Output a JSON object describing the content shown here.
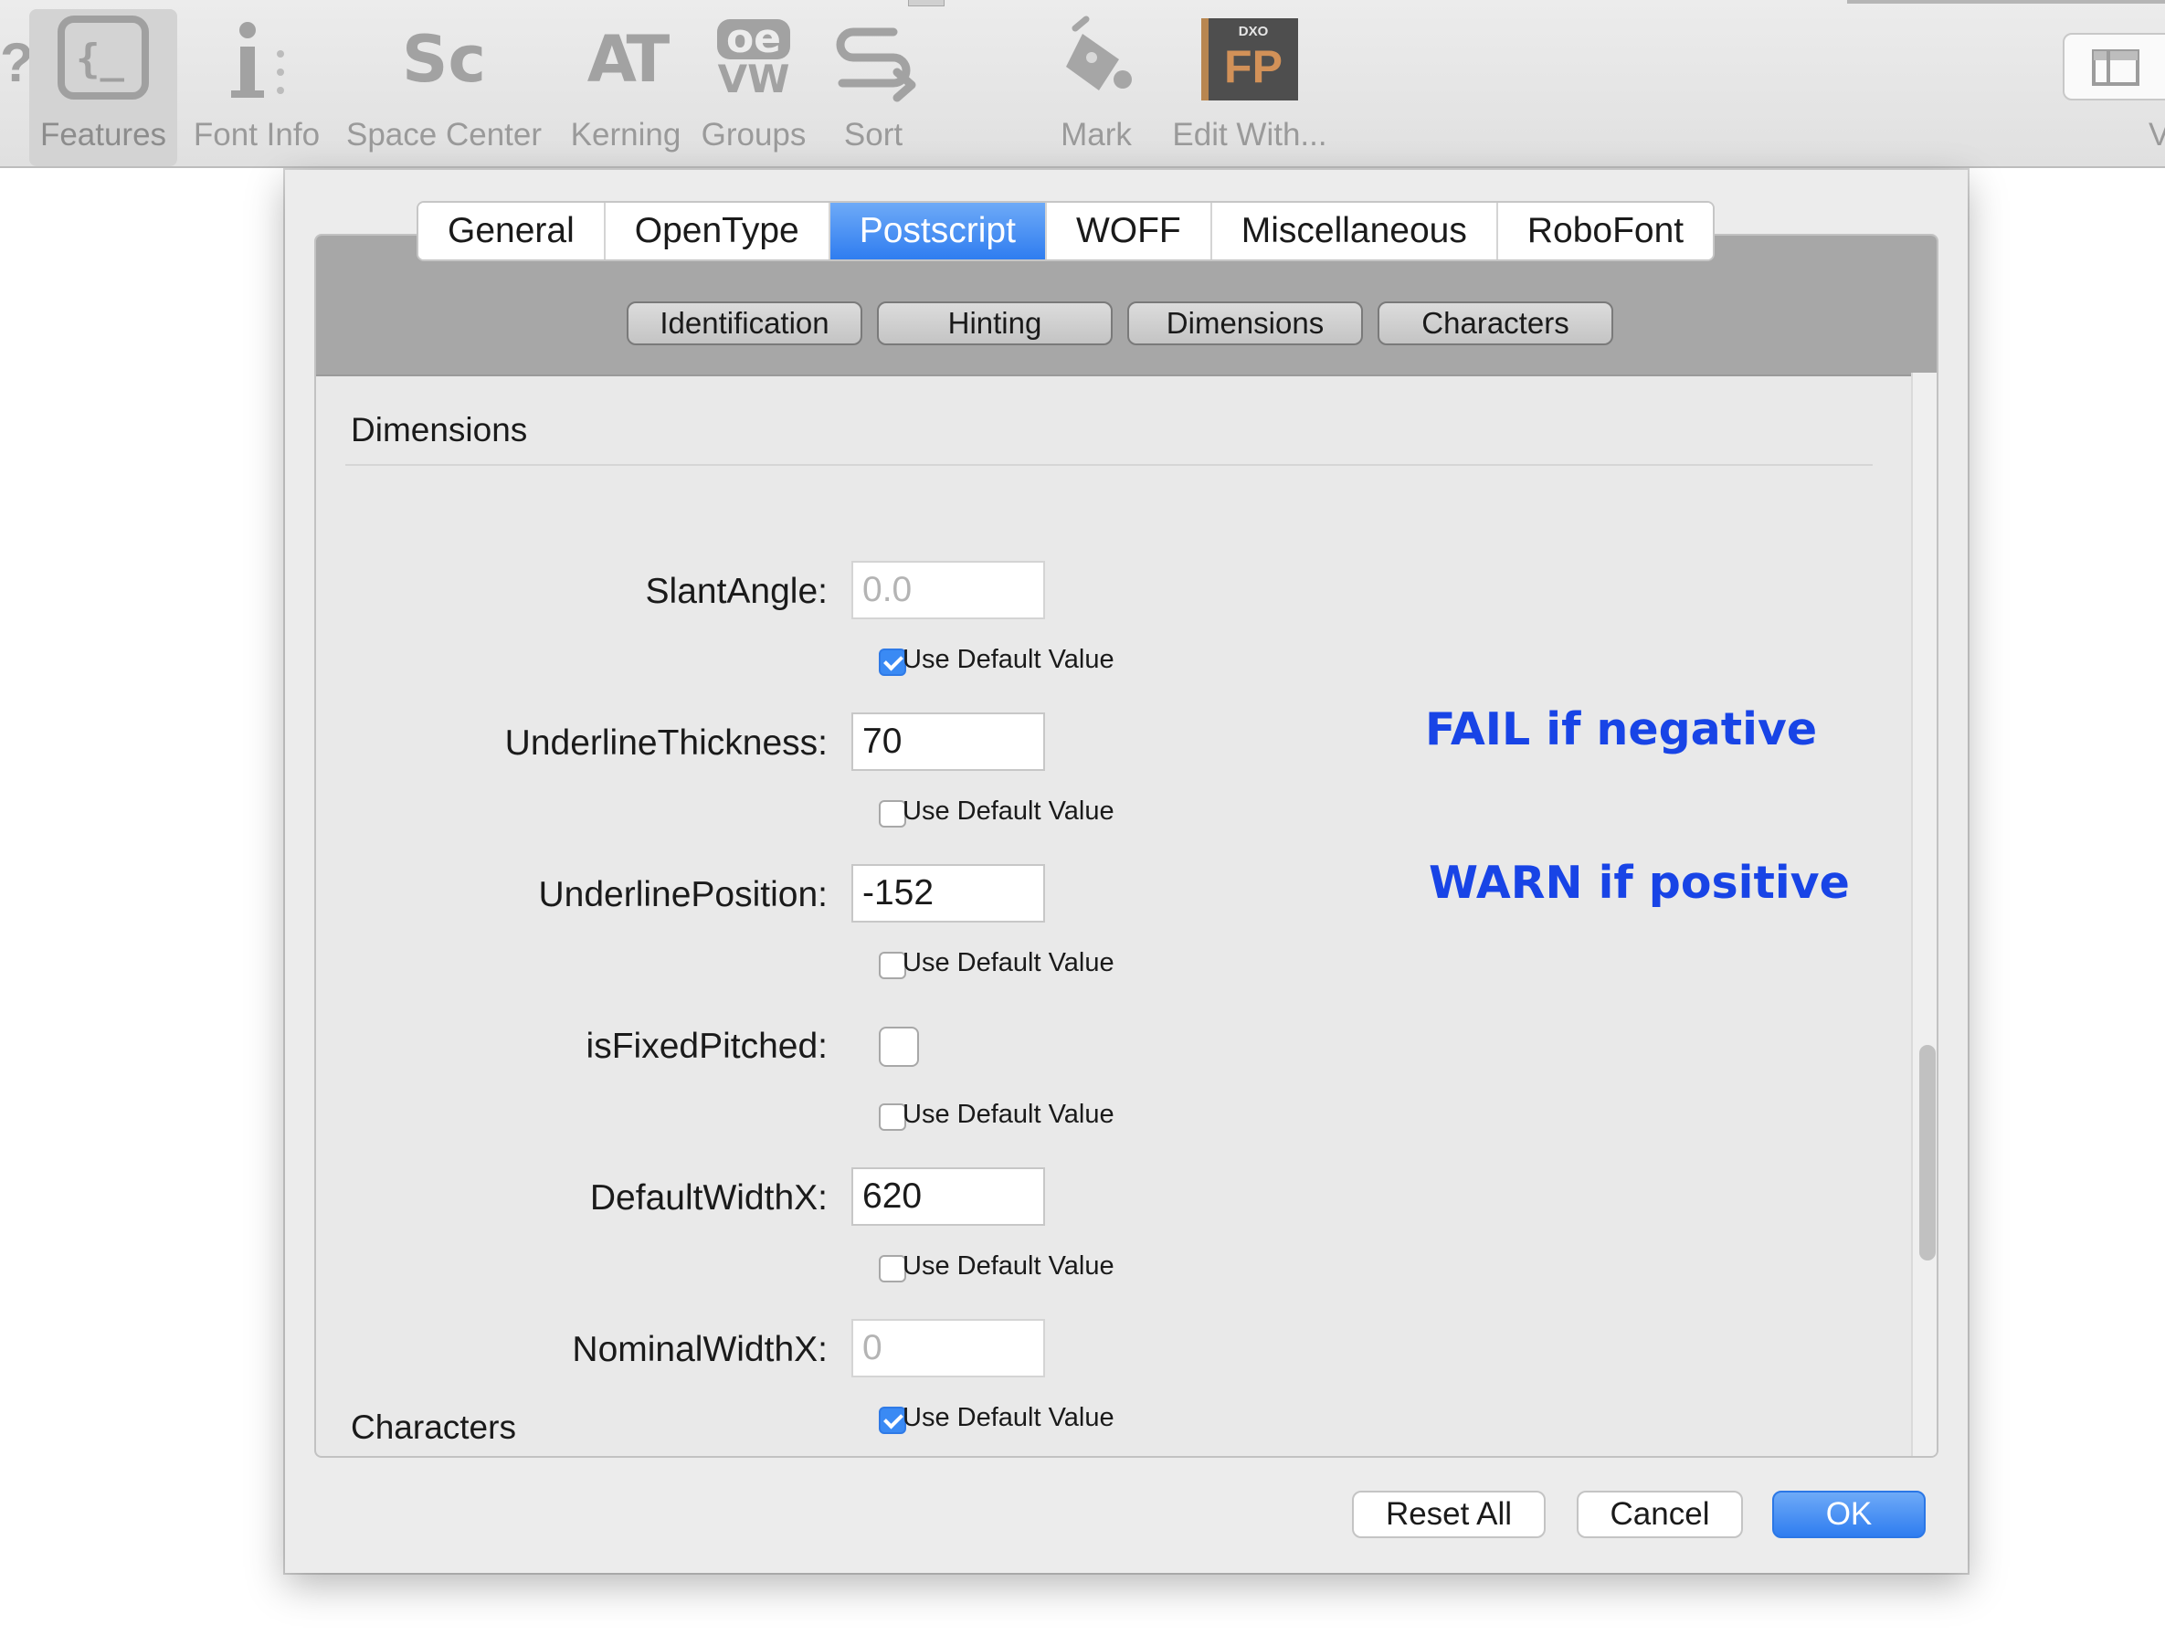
{
  "toolbar": {
    "items": [
      {
        "label": "Features",
        "icon": "features-braces-icon",
        "active": true
      },
      {
        "label": "Font Info",
        "icon": "info-icon"
      },
      {
        "label": "Space Center",
        "icon": "space-center-icon",
        "glyph": "Sc"
      },
      {
        "label": "Kerning",
        "icon": "kerning-icon",
        "glyph": "AT"
      },
      {
        "label": "Groups",
        "icon": "groups-icon",
        "glyph_top": "oe",
        "glyph_bottom": "VW"
      },
      {
        "label": "Sort",
        "icon": "sort-icon"
      },
      {
        "label": "Mark",
        "icon": "mark-paint-icon"
      },
      {
        "label": "Edit With...",
        "icon": "dxo-fp-app-icon",
        "badge_small": "DXO",
        "badge_big": "FP"
      }
    ],
    "edge_left_glyph": "?",
    "edge_right_glyph": "V"
  },
  "dialog": {
    "tabs": [
      "General",
      "OpenType",
      "Postscript",
      "WOFF",
      "Miscellaneous",
      "RoboFont"
    ],
    "selected_tab": "Postscript",
    "subtabs": [
      "Identification",
      "Hinting",
      "Dimensions",
      "Characters"
    ],
    "section_title": "Dimensions",
    "next_section_title": "Characters",
    "checkbox_label": "Use Default Value",
    "fields": {
      "slant_angle": {
        "label": "SlantAngle:",
        "value": "0.0",
        "use_default": true
      },
      "underline_thickness": {
        "label": "UnderlineThickness:",
        "value": "70",
        "use_default": false
      },
      "underline_position": {
        "label": "UnderlinePosition:",
        "value": "-152",
        "use_default": false
      },
      "is_fixed_pitched": {
        "label": "isFixedPitched:",
        "checked": false,
        "use_default": false
      },
      "default_width_x": {
        "label": "DefaultWidthX:",
        "value": "620",
        "use_default": false
      },
      "nominal_width_x": {
        "label": "NominalWidthX:",
        "value": "0",
        "use_default": true
      }
    },
    "annotations": {
      "thickness": "FAIL if negative",
      "position": "WARN if positive"
    },
    "buttons": {
      "reset": "Reset All",
      "cancel": "Cancel",
      "ok": "OK"
    },
    "accent_color": "#2f7df0",
    "annotation_color": "#1844e6"
  }
}
